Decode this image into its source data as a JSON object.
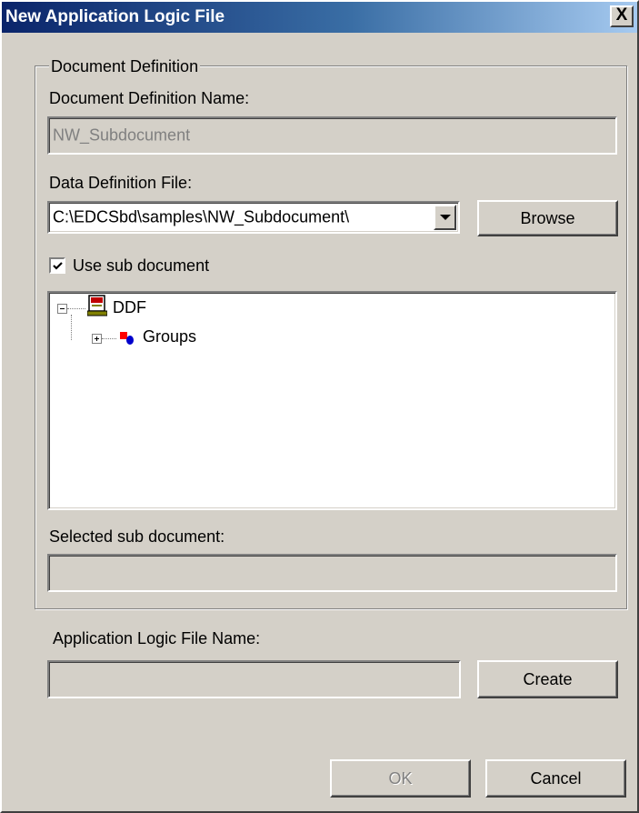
{
  "window": {
    "title": "New Application Logic File",
    "close_glyph": "X"
  },
  "document_definition": {
    "group_label": "Document Definition",
    "name_label": "Document Definition Name:",
    "name_value": "NW_Subdocument",
    "ddf_label": "Data Definition File:",
    "ddf_value": "C:\\EDCSbd\\samples\\NW_Subdocument\\",
    "browse_label": "Browse",
    "use_sub_label": "Use sub document",
    "use_sub_checked": true,
    "tree": {
      "root_label": "DDF",
      "root_icon": "ddf-document-icon",
      "child_label": "Groups",
      "child_icon": "groups-icon"
    },
    "selected_label": "Selected sub document:",
    "selected_value": ""
  },
  "app_logic": {
    "name_label": "Application Logic File Name:",
    "name_value": "",
    "create_label": "Create"
  },
  "footer": {
    "ok_label": "OK",
    "cancel_label": "Cancel"
  },
  "colors": {
    "title_start": "#0a246a",
    "title_end": "#a6caf0",
    "dialog_face": "#d4d0c8"
  }
}
